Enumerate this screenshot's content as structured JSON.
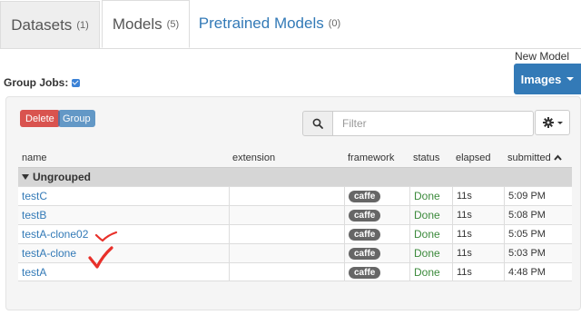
{
  "tabs": [
    {
      "label": "Datasets",
      "count": "(1)"
    },
    {
      "label": "Models",
      "count": "(5)"
    },
    {
      "label": "Pretrained Models",
      "count": "(0)"
    }
  ],
  "new_model": {
    "label": "New Model",
    "button": "Images"
  },
  "group_jobs": {
    "label": "Group Jobs:",
    "checked": true
  },
  "toolbar": {
    "delete_label": "Delete",
    "group_label": "Group",
    "filter_placeholder": "Filter"
  },
  "table": {
    "headers": [
      "name",
      "extension",
      "framework",
      "status",
      "elapsed",
      "submitted"
    ],
    "group_label": "Ungrouped",
    "rows": [
      {
        "name": "testC",
        "extension": "",
        "framework": "caffe",
        "status": "Done",
        "elapsed": "11s",
        "submitted": "5:09 PM"
      },
      {
        "name": "testB",
        "extension": "",
        "framework": "caffe",
        "status": "Done",
        "elapsed": "11s",
        "submitted": "5:08 PM"
      },
      {
        "name": "testA-clone02",
        "extension": "",
        "framework": "caffe",
        "status": "Done",
        "elapsed": "11s",
        "submitted": "5:05 PM"
      },
      {
        "name": "testA-clone",
        "extension": "",
        "framework": "caffe",
        "status": "Done",
        "elapsed": "11s",
        "submitted": "5:03 PM"
      },
      {
        "name": "testA",
        "extension": "",
        "framework": "caffe",
        "status": "Done",
        "elapsed": "11s",
        "submitted": "4:48 PM"
      }
    ]
  },
  "colors": {
    "accent": "#337ab7",
    "danger": "#d9534f",
    "success": "#3c8a3c",
    "annotation": "#e8302a"
  }
}
